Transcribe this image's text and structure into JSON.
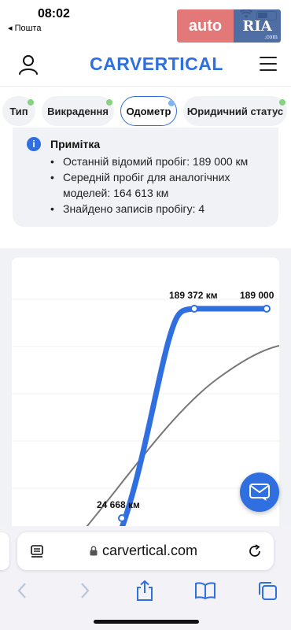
{
  "status_bar": {
    "time": "08:02",
    "back_app": "◂ Пошта"
  },
  "overlay_badge": {
    "left_text": "auto",
    "right_text": "RIA",
    "right_sub": ".com"
  },
  "header": {
    "logo": "CARVERTICAL"
  },
  "tabs": [
    {
      "label": "Тип",
      "active": false
    },
    {
      "label": "Викрадення",
      "active": false
    },
    {
      "label": "Одометр",
      "active": true
    },
    {
      "label": "Юридичний статус",
      "active": false
    }
  ],
  "note": {
    "title": "Примітка",
    "items": [
      "Останній відомий пробіг: 189 000 км",
      "Середній пробіг для аналогічних моделей: 164 613 км",
      "Знайдено записів пробігу: 4"
    ]
  },
  "chart": {
    "labels": {
      "peak": "189 372 км",
      "last": "189 000",
      "low": "24 668 км"
    },
    "colors": {
      "mileage_line": "#2f6fe0",
      "average_line": "#777777"
    }
  },
  "chart_data": {
    "type": "line",
    "series": [
      {
        "values": [
          24668,
          189372,
          189000
        ]
      }
    ],
    "data_labels": [
      "24 668 км",
      "189 372 км",
      "189 000"
    ]
  },
  "browser": {
    "url": "carvertical.com"
  },
  "colors": {
    "brand": "#2f6fe0",
    "tab_done_dot": "#83d47a",
    "card_bg": "#f1f2f5"
  }
}
